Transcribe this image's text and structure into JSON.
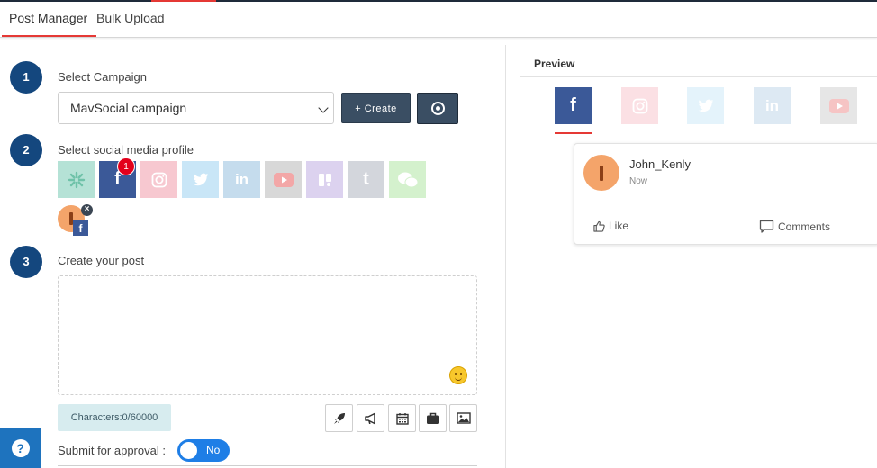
{
  "tabs": [
    {
      "label": "Post Manager",
      "active": true
    },
    {
      "label": "Bulk Upload",
      "active": false
    }
  ],
  "steps": {
    "one": {
      "number": "1",
      "label": "Select Campaign"
    },
    "two": {
      "number": "2",
      "label": "Select social media profile"
    },
    "three": {
      "number": "3",
      "label": "Create your post"
    }
  },
  "campaign": {
    "selected": "MavSocial campaign",
    "create_label": "+ Create"
  },
  "social_profiles": [
    {
      "icon": "hootsuite-icon",
      "color": "#b5e2d6"
    },
    {
      "icon": "facebook-icon",
      "color": "#3b5998",
      "badge": "1"
    },
    {
      "icon": "instagram-icon",
      "color": "#f7c8d0"
    },
    {
      "icon": "twitter-icon",
      "color": "#c9e6f7"
    },
    {
      "icon": "linkedin-icon",
      "color": "#c5dced"
    },
    {
      "icon": "youtube-icon",
      "color": "#d8d8d8"
    },
    {
      "icon": "google-my-business-icon",
      "color": "#dcd2ef"
    },
    {
      "icon": "tumblr-icon",
      "color": "#d3d6dc"
    },
    {
      "icon": "wechat-icon",
      "color": "#d4f1cd"
    }
  ],
  "post": {
    "characters": "Characters:0/60000",
    "submit_label": "Submit for approval :",
    "approval_toggle": "No"
  },
  "preview": {
    "title": "Preview",
    "tabs": [
      {
        "icon": "facebook-icon",
        "color": "#3b5998",
        "active": true
      },
      {
        "icon": "instagram-icon",
        "color": "#fbe0e4"
      },
      {
        "icon": "twitter-icon",
        "color": "#e4f3fb"
      },
      {
        "icon": "linkedin-icon",
        "color": "#dde9f3"
      },
      {
        "icon": "youtube-icon",
        "color": "#e6e6e6"
      }
    ],
    "card": {
      "name": "John_Kenly",
      "time": "Now",
      "like_label": "Like",
      "comments_label": "Comments"
    }
  },
  "colors": {
    "accent_red": "#e53935",
    "step_blue": "#14477e",
    "button_dark": "#3a4e63",
    "toggle_blue": "#1e7ee6",
    "help_blue": "#1e73be"
  }
}
